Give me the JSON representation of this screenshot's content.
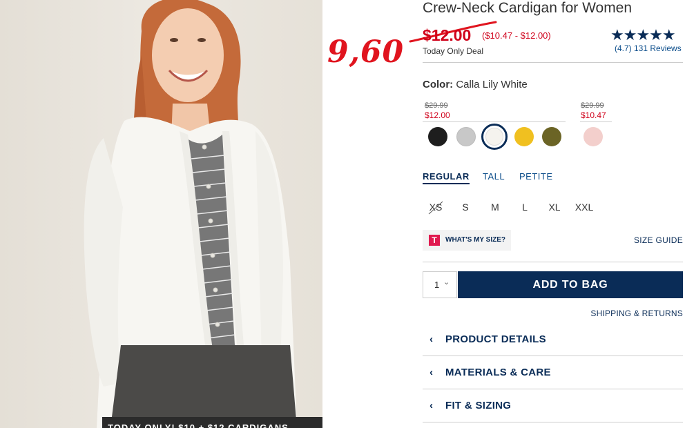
{
  "product": {
    "title": "Crew-Neck Cardigan for Women",
    "price": "$12.00",
    "price_range": "($10.47 - $12.00)",
    "deal_label": "Today Only Deal",
    "stars": "★★★★★",
    "rating": "(4.7) 131 Reviews"
  },
  "annotation": {
    "handwritten_price": "9,60"
  },
  "color": {
    "label": "Color:",
    "value": "Calla Lily White",
    "groups": [
      {
        "was": "$29.99",
        "now": "$12.00"
      },
      {
        "was": "$29.99",
        "now": "$10.47"
      }
    ],
    "swatches": [
      {
        "name": "black",
        "hex": "#1e1e1e"
      },
      {
        "name": "heather-gray",
        "hex": "#c8c8c8"
      },
      {
        "name": "calla-lily-white",
        "hex": "#f5f3ee"
      },
      {
        "name": "yellow",
        "hex": "#f0c020"
      },
      {
        "name": "olive",
        "hex": "#6b6425"
      },
      {
        "name": "light-pink",
        "hex": "#f3cfcc"
      }
    ]
  },
  "fit_tabs": [
    "REGULAR",
    "TALL",
    "PETITE"
  ],
  "sizes": [
    "XS",
    "S",
    "M",
    "L",
    "XL",
    "XXL"
  ],
  "whats_my_size": {
    "logo": "T",
    "label": "WHAT'S MY SIZE?"
  },
  "size_guide": "SIZE GUIDE",
  "quantity": {
    "value": "1",
    "chevron": "⌄"
  },
  "add_to_bag": "ADD TO BAG",
  "shipping_returns": "SHIPPING & RETURNS",
  "accordions": [
    "PRODUCT DETAILS",
    "MATERIALS & CARE",
    "FIT & SIZING"
  ],
  "banner": "TODAY ONLY! $10 + $12 CARDIGANS",
  "colors": {
    "navy": "#0a2c57",
    "sale_red": "#d0021b",
    "annotation_red": "#e0141e"
  }
}
